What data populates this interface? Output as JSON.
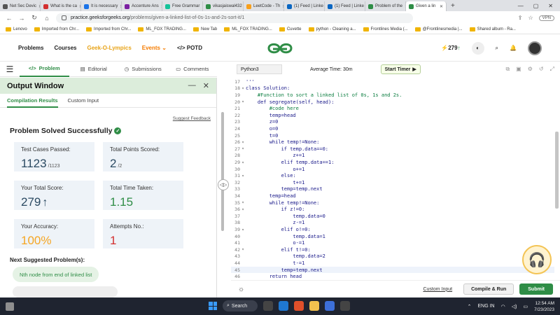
{
  "browser": {
    "tabs": [
      {
        "label": "Net Sec Devic",
        "color": "#555"
      },
      {
        "label": "What is the ca",
        "color": "#d32f2f"
      },
      {
        "label": "It is necessary",
        "color": "#1a73e8"
      },
      {
        "label": "Accenture Ans",
        "color": "#7b1fa2"
      },
      {
        "label": "Free Grammar",
        "color": "#15c39a"
      },
      {
        "label": "vikasjaiswal432",
        "color": "#2f8d46"
      },
      {
        "label": "LeetCode - Th",
        "color": "#f89f1b"
      },
      {
        "label": "(1) Feed | Linke",
        "color": "#0a66c2"
      },
      {
        "label": "(1) Feed | Linke",
        "color": "#0a66c2"
      },
      {
        "label": "Problem of the",
        "color": "#2f8d46"
      },
      {
        "label": "Given a lin",
        "color": "#2f8d46"
      }
    ],
    "url_host": "practice.geeksforgeeks.org",
    "url_path": "/problems/given-a-linked-list-of-0s-1s-and-2s-sort-it/1",
    "vpn": "VPN",
    "bookmarks": [
      "Lenovo",
      "Imported from Chr...",
      "Imported from Chr...",
      "ML_FOX TRADING...",
      "New Tab",
      "ML_FOX TRADING...",
      "Cuvette",
      "python - Cleaning a...",
      "Frontlines Media (...",
      "@Frontlinesmedia |...",
      "Shared album - Ra..."
    ]
  },
  "header": {
    "nav": [
      "Problems",
      "Courses",
      "Geek-O-Lympics",
      "Events",
      "POTD"
    ],
    "logo": "GG",
    "streak": "279"
  },
  "left_tabs": [
    "Problem",
    "Editorial",
    "Submissions",
    "Comments"
  ],
  "output": {
    "title": "Output Window",
    "tabs": [
      "Compilation Results",
      "Custom Input"
    ],
    "suggest_feedback": "Suggest Feedback",
    "solved": "Problem Solved Successfully",
    "cards": {
      "tests_label": "Test Cases Passed:",
      "tests_val": "1123",
      "tests_total": "/1123",
      "points_label": "Total Points Scored:",
      "points_val": "2",
      "points_total": "/2",
      "score_label": "Your Total Score:",
      "score_val": "279",
      "time_label": "Total Time Taken:",
      "time_val": "1.15",
      "acc_label": "Your Accuracy:",
      "acc_val": "100%",
      "attempts_label": "Attempts No.:",
      "attempts_val": "1"
    },
    "next_title": "Next Suggested Problem(s):",
    "next_item": "Nth node from end of linked list"
  },
  "editor": {
    "language": "Python3",
    "avg_time": "Average Time: 30m",
    "start_timer": "Start Timer",
    "custom_input": "Custom Input",
    "compile_run": "Compile & Run",
    "submit": "Submit",
    "lines": [
      {
        "n": "17",
        "f": "",
        "t": "'''"
      },
      {
        "n": "18",
        "f": "▾",
        "t": "class Solution:"
      },
      {
        "n": "19",
        "f": "",
        "t": "    #Function to sort a linked list of 0s, 1s and 2s.",
        "c": true
      },
      {
        "n": "20",
        "f": "▾",
        "t": "    def segregate(self, head):"
      },
      {
        "n": "21",
        "f": "",
        "t": "        #code here",
        "c": true
      },
      {
        "n": "22",
        "f": "",
        "t": "        temp=head"
      },
      {
        "n": "23",
        "f": "",
        "t": "        z=0"
      },
      {
        "n": "24",
        "f": "",
        "t": "        o=0"
      },
      {
        "n": "25",
        "f": "",
        "t": "        t=0"
      },
      {
        "n": "26",
        "f": "▾",
        "t": "        while temp!=None:"
      },
      {
        "n": "27",
        "f": "▾",
        "t": "            if temp.data==0:"
      },
      {
        "n": "28",
        "f": "",
        "t": "                z+=1"
      },
      {
        "n": "29",
        "f": "▾",
        "t": "            elif temp.data==1:"
      },
      {
        "n": "30",
        "f": "",
        "t": "                o+=1"
      },
      {
        "n": "31",
        "f": "▾",
        "t": "            else:"
      },
      {
        "n": "32",
        "f": "",
        "t": "                t+=1"
      },
      {
        "n": "33",
        "f": "",
        "t": "            temp=temp.next"
      },
      {
        "n": "34",
        "f": "",
        "t": "        temp=head"
      },
      {
        "n": "35",
        "f": "▾",
        "t": "        while temp!=None:"
      },
      {
        "n": "36",
        "f": "▾",
        "t": "            if z!=0:"
      },
      {
        "n": "37",
        "f": "",
        "t": "                temp.data=0"
      },
      {
        "n": "38",
        "f": "",
        "t": "                z-=1"
      },
      {
        "n": "39",
        "f": "▾",
        "t": "            elif o!=0:"
      },
      {
        "n": "40",
        "f": "",
        "t": "                temp.data=1"
      },
      {
        "n": "41",
        "f": "",
        "t": "                o-=1"
      },
      {
        "n": "42",
        "f": "▾",
        "t": "            elif t!=0:"
      },
      {
        "n": "43",
        "f": "",
        "t": "                temp.data=2"
      },
      {
        "n": "44",
        "f": "",
        "t": "                t-=1"
      },
      {
        "n": "45",
        "f": "",
        "t": "            temp=temp.next",
        "cur": true
      },
      {
        "n": "46",
        "f": "",
        "t": "        return head"
      }
    ]
  },
  "taskbar": {
    "search": "Search",
    "time": "12:54 AM",
    "date": "7/23/2023",
    "lang": "ENG IN"
  },
  "colors": {
    "brand_green": "#2f8d46"
  }
}
